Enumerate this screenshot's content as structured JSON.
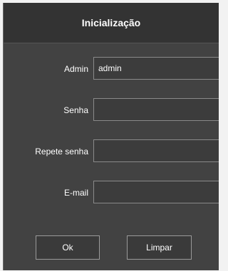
{
  "dialog": {
    "title": "Inicialização"
  },
  "form": {
    "admin": {
      "label": "Admin",
      "value": "admin"
    },
    "senha": {
      "label": "Senha",
      "value": ""
    },
    "repete_senha": {
      "label": "Repete senha",
      "value": ""
    },
    "email": {
      "label": "E-mail",
      "value": ""
    }
  },
  "buttons": {
    "ok": "Ok",
    "limpar": "Limpar"
  },
  "colors": {
    "dialog_bg": "#424242",
    "titlebar_bg": "#333333",
    "text": "#ffffff",
    "border": "#8a8a8a"
  }
}
